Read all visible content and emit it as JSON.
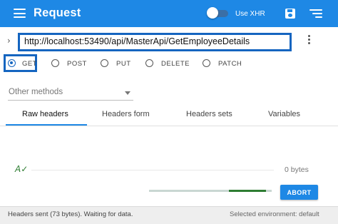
{
  "app": {
    "title": "Request",
    "use_xhr_label": "Use XHR",
    "xhr_enabled": true
  },
  "url": {
    "value": "http://localhost:53490/api/MasterApi/GetEmployeeDetails"
  },
  "methods": {
    "selected": "GET",
    "options": [
      {
        "label": "GET"
      },
      {
        "label": "POST"
      },
      {
        "label": "PUT"
      },
      {
        "label": "DELETE"
      },
      {
        "label": "PATCH"
      }
    ],
    "other_placeholder": "Other methods"
  },
  "tabs": [
    {
      "label": "Raw headers",
      "active": true
    },
    {
      "label": "Headers form",
      "active": false
    },
    {
      "label": "Headers sets",
      "active": false
    },
    {
      "label": "Variables",
      "active": false
    }
  ],
  "editor": {
    "size": "0 bytes"
  },
  "request": {
    "progress": 0.3,
    "abort_label": "ABORT"
  },
  "status": {
    "left": "Headers sent (73 bytes). Waiting for data.",
    "right": "Selected environment: default"
  },
  "colors": {
    "primary": "#1e88e5",
    "highlight": "#1565c0",
    "progress": "#2e7d32"
  },
  "icons": [
    "menu-icon",
    "save-icon",
    "sort-icon",
    "chevron-right-icon",
    "more-vert-icon",
    "dropdown-arrow-icon",
    "validation-check-icon"
  ]
}
